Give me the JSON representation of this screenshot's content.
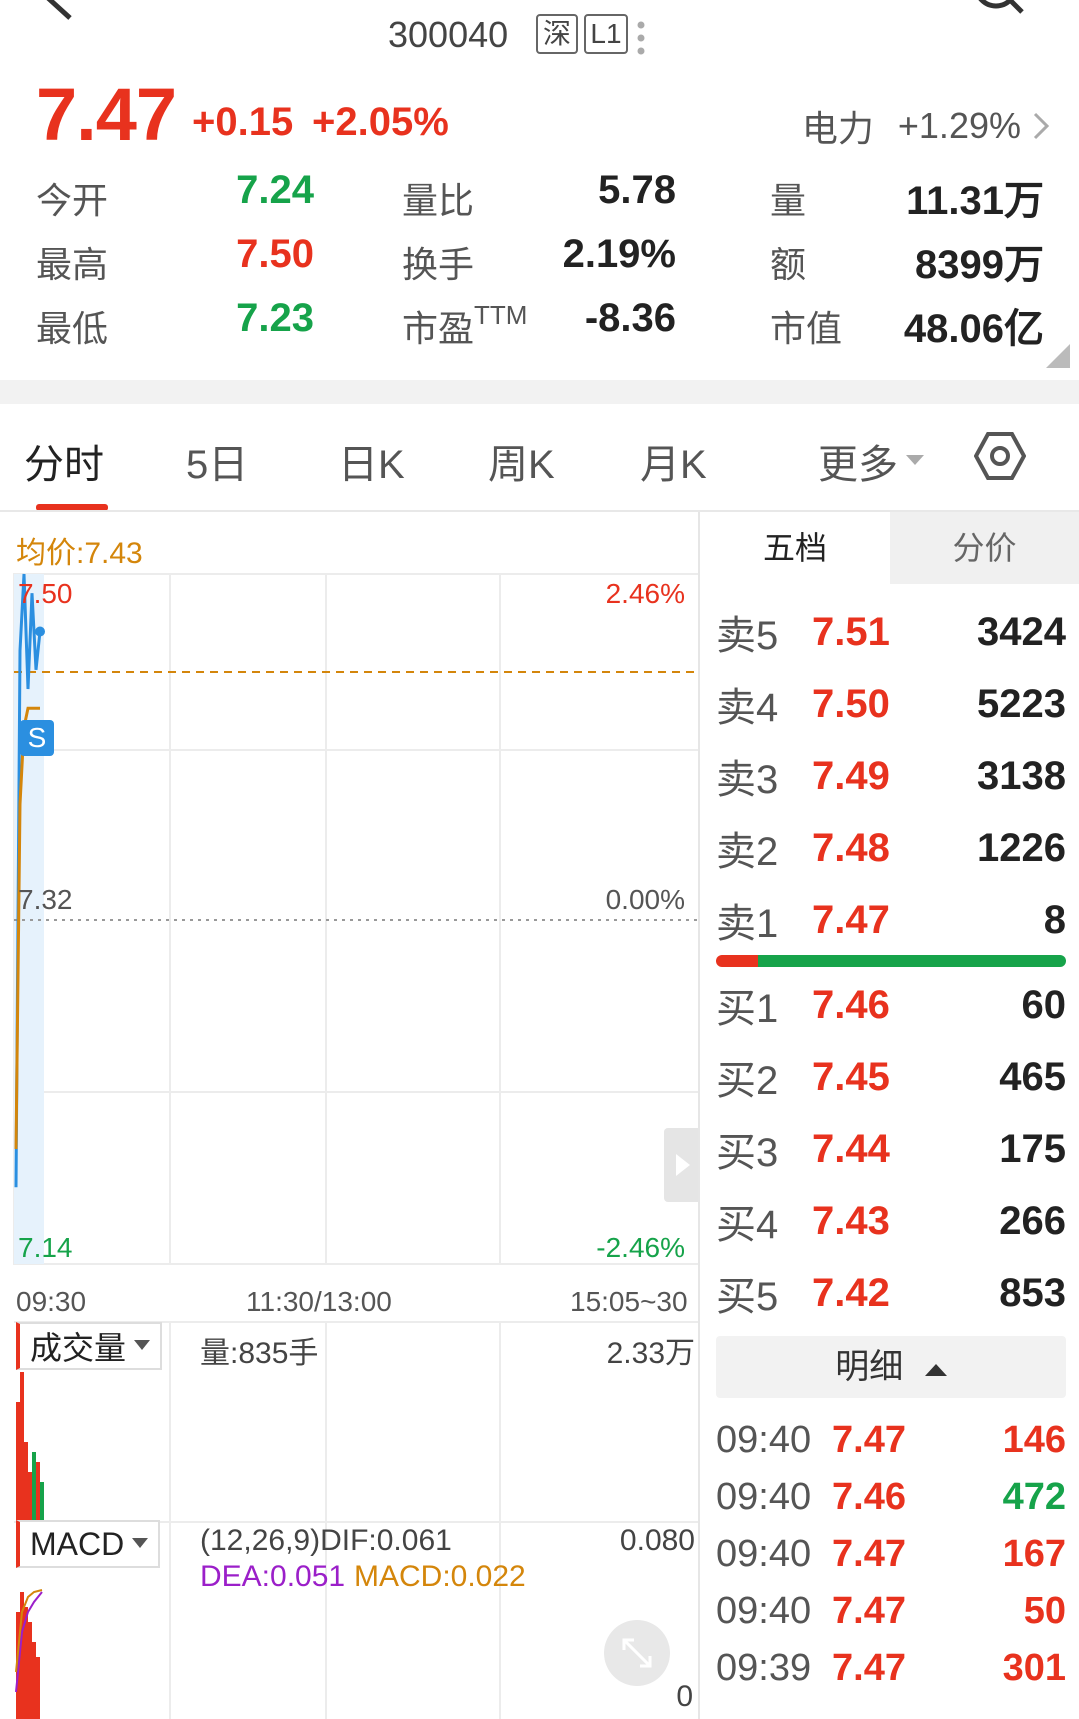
{
  "header": {
    "code": "300040",
    "market_badge": "深",
    "level_badge": "L1"
  },
  "quote": {
    "price": "7.47",
    "change": "+0.15",
    "change_pct": "+2.05%",
    "sector_name": "电力",
    "sector_pct": "+1.29%",
    "stats": [
      {
        "label": "今开",
        "value": "7.24",
        "color": "#16a34a"
      },
      {
        "label": "最高",
        "value": "7.50",
        "color": "#e8321e"
      },
      {
        "label": "最低",
        "value": "7.23",
        "color": "#16a34a"
      },
      {
        "label": "量比",
        "value": "5.78",
        "color": "#222222"
      },
      {
        "label": "换手",
        "value": "2.19%",
        "color": "#222222"
      },
      {
        "label": "市盈",
        "label_sup": "TTM",
        "value": "-8.36",
        "color": "#222222"
      },
      {
        "label": "量",
        "value": "11.31万",
        "color": "#222222"
      },
      {
        "label": "额",
        "value": "8399万",
        "color": "#222222"
      },
      {
        "label": "市值",
        "value": "48.06亿",
        "color": "#222222"
      }
    ]
  },
  "tabs": [
    "分时",
    "5日",
    "日K",
    "周K",
    "月K",
    "更多"
  ],
  "chart": {
    "avg_label": "均价:7.43",
    "y_high": "7.50",
    "y_mid": "7.32",
    "y_low": "7.14",
    "pct_high": "2.46%",
    "pct_mid": "0.00%",
    "pct_low": "-2.46%",
    "time_start": "09:30",
    "time_mid": "11:30/13:00",
    "time_end": "15:05~30",
    "s_marker": "S",
    "volume_tag": "成交量",
    "volume_text": "量:835手",
    "volume_max": "2.33万",
    "macd_tag": "MACD",
    "macd_params": "(12,26,9)DIF:0.061",
    "macd_dea": "DEA:0.051",
    "macd_val": "MACD:0.022",
    "macd_max": "0.080",
    "macd_zero": "0"
  },
  "chart_data": {
    "type": "line",
    "series": [
      {
        "values": [
          7.18,
          7.46,
          7.5,
          7.44,
          7.49,
          7.45,
          7.47
        ]
      },
      {
        "values": [
          7.2,
          7.38,
          7.42,
          7.43,
          7.43,
          7.43,
          7.43
        ]
      }
    ],
    "ylim": [
      7.14,
      7.5
    ]
  },
  "order_book": {
    "tabs": [
      "五档",
      "分价"
    ],
    "asks": [
      {
        "label": "卖5",
        "price": "7.51",
        "vol": "3424"
      },
      {
        "label": "卖4",
        "price": "7.50",
        "vol": "5223"
      },
      {
        "label": "卖3",
        "price": "7.49",
        "vol": "3138"
      },
      {
        "label": "卖2",
        "price": "7.48",
        "vol": "1226"
      },
      {
        "label": "卖1",
        "price": "7.47",
        "vol": "8"
      }
    ],
    "bids": [
      {
        "label": "买1",
        "price": "7.46",
        "vol": "60"
      },
      {
        "label": "买2",
        "price": "7.45",
        "vol": "465"
      },
      {
        "label": "买3",
        "price": "7.44",
        "vol": "175"
      },
      {
        "label": "买4",
        "price": "7.43",
        "vol": "266"
      },
      {
        "label": "买5",
        "price": "7.42",
        "vol": "853"
      }
    ],
    "detail_label": "明细",
    "ticks": [
      {
        "time": "09:40",
        "price": "7.47",
        "vol": "146",
        "color": "#e8321e"
      },
      {
        "time": "09:40",
        "price": "7.46",
        "vol": "472",
        "color": "#16a34a"
      },
      {
        "time": "09:40",
        "price": "7.47",
        "vol": "167",
        "color": "#e8321e"
      },
      {
        "time": "09:40",
        "price": "7.47",
        "vol": "50",
        "color": "#e8321e"
      },
      {
        "time": "09:39",
        "price": "7.47",
        "vol": "301",
        "color": "#e8321e"
      }
    ]
  },
  "colors": {
    "up": "#e8321e",
    "down": "#16a34a",
    "avg": "#d4860b",
    "price_line": "#2b8fe0"
  }
}
